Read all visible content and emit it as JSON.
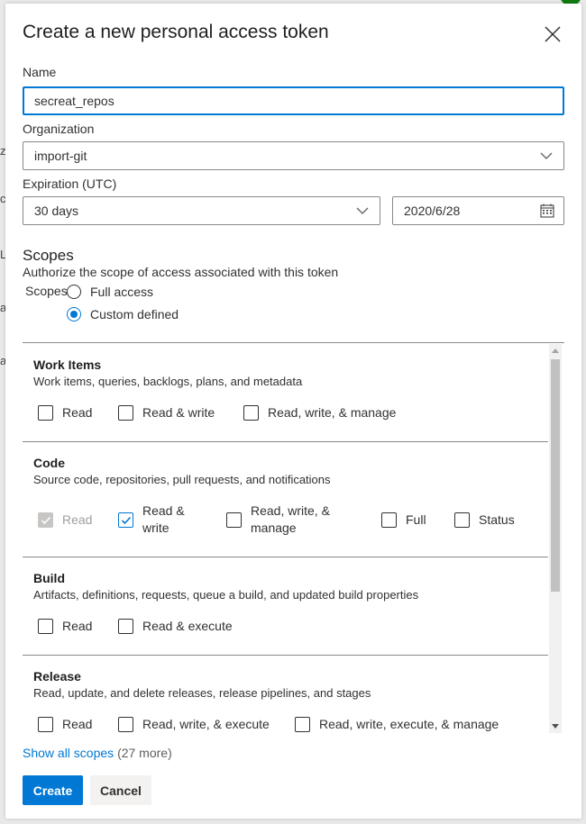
{
  "background": {
    "frag_1": "ze",
    "frag_2": "ce",
    "frag_3": "L",
    "frag_4": "a",
    "frag_5": "a"
  },
  "dialog": {
    "title": "Create a new personal access token",
    "close_icon": "close-icon"
  },
  "form": {
    "name_label": "Name",
    "name_value": "secreat_repos",
    "org_label": "Organization",
    "org_value": "import-git",
    "expiration_label": "Expiration (UTC)",
    "expiration_value": "30 days",
    "expiration_date": "2020/6/28"
  },
  "scopes": {
    "heading": "Scopes",
    "subtitle": "Authorize the scope of access associated with this token",
    "radio_label": "Scopes",
    "options": [
      {
        "label": "Full access",
        "selected": false
      },
      {
        "label": "Custom defined",
        "selected": true
      }
    ]
  },
  "sections": [
    {
      "title": "Work Items",
      "desc": "Work items, queries, backlogs, plans, and metadata",
      "checks": [
        {
          "label": "Read",
          "checked": false,
          "disabled": false
        },
        {
          "label": "Read & write",
          "checked": false,
          "disabled": false
        },
        {
          "label": "Read, write, & manage",
          "checked": false,
          "disabled": false
        }
      ]
    },
    {
      "title": "Code",
      "desc": "Source code, repositories, pull requests, and notifications",
      "checks": [
        {
          "label": "Read",
          "checked": true,
          "disabled": true
        },
        {
          "label_line1": "Read &",
          "label_line2": "write",
          "checked": true,
          "disabled": false
        },
        {
          "label_line1": "Read, write, &",
          "label_line2": "manage",
          "checked": false,
          "disabled": false
        },
        {
          "label": "Full",
          "checked": false,
          "disabled": false
        },
        {
          "label": "Status",
          "checked": false,
          "disabled": false
        }
      ]
    },
    {
      "title": "Build",
      "desc": "Artifacts, definitions, requests, queue a build, and updated build properties",
      "checks": [
        {
          "label": "Read",
          "checked": false,
          "disabled": false
        },
        {
          "label": "Read & execute",
          "checked": false,
          "disabled": false
        }
      ]
    },
    {
      "title": "Release",
      "desc": "Read, update, and delete releases, release pipelines, and stages",
      "checks": [
        {
          "label": "Read",
          "checked": false,
          "disabled": false
        },
        {
          "label": "Read, write, & execute",
          "checked": false,
          "disabled": false
        },
        {
          "label": "Read, write, execute, & manage",
          "checked": false,
          "disabled": false
        }
      ]
    }
  ],
  "footer": {
    "show_all_link": "Show all scopes",
    "show_all_count": "(27 more)",
    "create_label": "Create",
    "cancel_label": "Cancel"
  },
  "colors": {
    "accent": "#0078d4",
    "border": "#8a8886",
    "text": "#323130"
  }
}
